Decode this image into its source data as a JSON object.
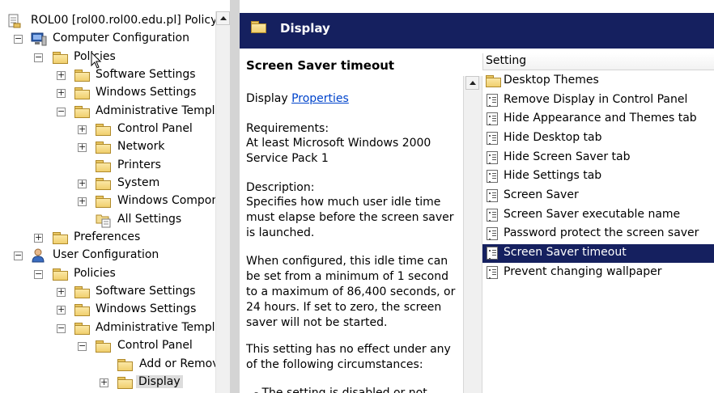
{
  "tree": {
    "items": [
      {
        "label": "ROL00 [rol00.rol00.edu.pl] Policy",
        "icon": "policy-doc-icon",
        "expander": ""
      },
      {
        "label": "Computer Configuration",
        "icon": "computer-icon",
        "expander": "−"
      },
      {
        "label": "Policies",
        "icon": "folder-icon",
        "expander": "−"
      },
      {
        "label": "Software Settings",
        "icon": "folder-icon",
        "expander": "+"
      },
      {
        "label": "Windows Settings",
        "icon": "folder-icon",
        "expander": "+"
      },
      {
        "label": "Administrative Templa",
        "icon": "folder-icon",
        "expander": "−"
      },
      {
        "label": "Control Panel",
        "icon": "folder-icon",
        "expander": "+"
      },
      {
        "label": "Network",
        "icon": "folder-icon",
        "expander": "+"
      },
      {
        "label": "Printers",
        "icon": "folder-icon",
        "expander": ""
      },
      {
        "label": "System",
        "icon": "folder-icon",
        "expander": "+"
      },
      {
        "label": "Windows Compon",
        "icon": "folder-icon",
        "expander": "+"
      },
      {
        "label": "All Settings",
        "icon": "all-settings-icon",
        "expander": ""
      },
      {
        "label": "Preferences",
        "icon": "folder-icon",
        "expander": "+"
      },
      {
        "label": "User Configuration",
        "icon": "user-icon",
        "expander": "−"
      },
      {
        "label": "Policies",
        "icon": "folder-icon",
        "expander": "−"
      },
      {
        "label": "Software Settings",
        "icon": "folder-icon",
        "expander": "+"
      },
      {
        "label": "Windows Settings",
        "icon": "folder-icon",
        "expander": "+"
      },
      {
        "label": "Administrative Templa",
        "icon": "folder-icon",
        "expander": "−"
      },
      {
        "label": "Control Panel",
        "icon": "folder-icon",
        "expander": "−"
      },
      {
        "label": "Add or Remov",
        "icon": "folder-icon",
        "expander": ""
      },
      {
        "label": "Display",
        "icon": "folder-icon",
        "expander": "+"
      }
    ]
  },
  "header": {
    "title": "Display",
    "icon": "folder-icon"
  },
  "description": {
    "title": "Screen Saver timeout",
    "category_prefix": "Display",
    "properties_link": "Properties",
    "requirements_label": "Requirements:",
    "requirements_text": "At least Microsoft Windows 2000 Service Pack 1",
    "description_label": "Description:",
    "description_text": "Specifies how much user idle time must elapse before the screen saver is launched.",
    "para2": "When configured, this idle time can be set from a minimum of 1 second to a maximum of 86,400 seconds, or 24 hours. If set to zero, the screen saver will not be started.",
    "para3": "This setting has no effect under any of the following circumstances:",
    "para4": "- The setting is disabled or not"
  },
  "settings": {
    "column_header": "Setting",
    "rows": [
      {
        "label": "Desktop Themes",
        "icon": "folder-icon"
      },
      {
        "label": "Remove Display in Control Panel",
        "icon": "policy-setting-icon"
      },
      {
        "label": "Hide Appearance and Themes tab",
        "icon": "policy-setting-icon"
      },
      {
        "label": "Hide Desktop tab",
        "icon": "policy-setting-icon"
      },
      {
        "label": "Hide Screen Saver tab",
        "icon": "policy-setting-icon"
      },
      {
        "label": "Hide Settings tab",
        "icon": "policy-setting-icon"
      },
      {
        "label": "Screen Saver",
        "icon": "policy-setting-icon"
      },
      {
        "label": "Screen Saver executable name",
        "icon": "policy-setting-icon"
      },
      {
        "label": "Password protect the screen saver",
        "icon": "policy-setting-icon"
      },
      {
        "label": "Screen Saver timeout",
        "icon": "policy-setting-icon",
        "selected": true
      },
      {
        "label": "Prevent changing wallpaper",
        "icon": "policy-setting-icon"
      }
    ]
  },
  "colors": {
    "header_bg": "#15205f",
    "selection_bg": "#15205f",
    "link": "#0044cc"
  }
}
